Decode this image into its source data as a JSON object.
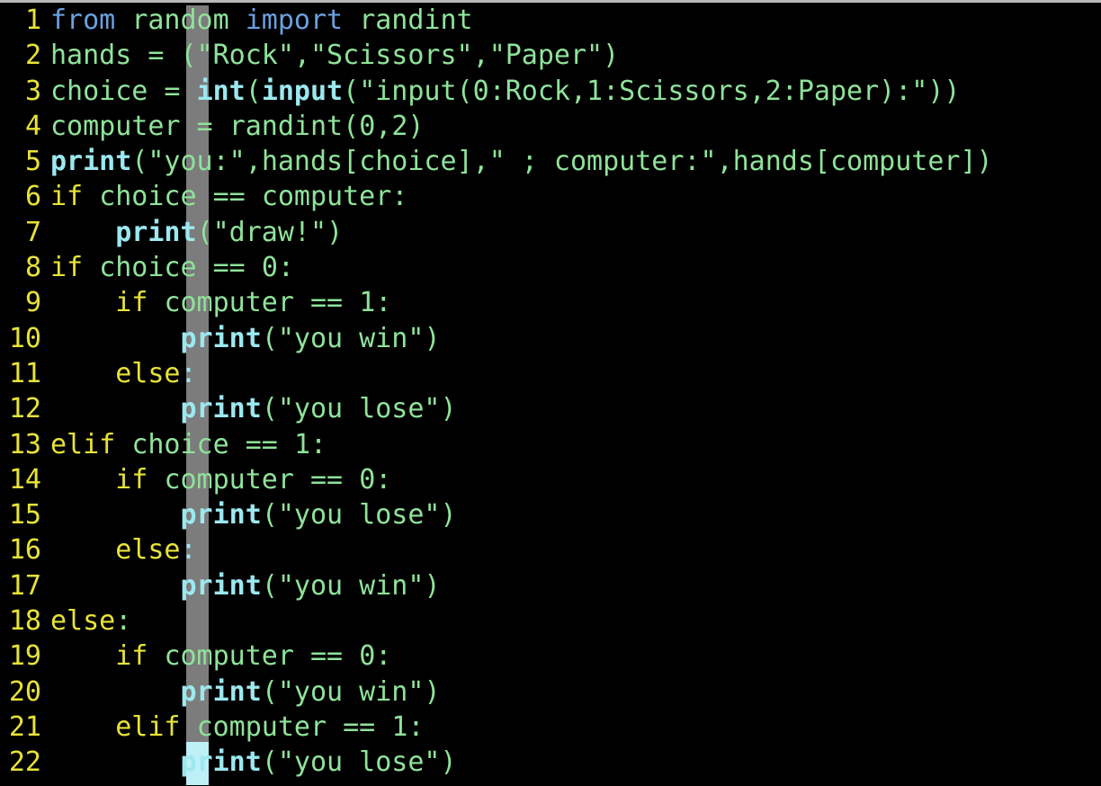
{
  "editor": {
    "title": "python-code-editor",
    "language": "Python",
    "background_color": "#000000",
    "gutter_color": "#e8e337",
    "indent_guide_color": "#7c7c7c",
    "cursor_color": "#bdf0f7",
    "top_border_color": "#b9b9b9",
    "total_lines": 22,
    "cursor": {
      "line": 22,
      "column": 9
    },
    "palette": {
      "keyword": "#e8e337",
      "import": "#6aa0e0",
      "builtin": "#9ce8f0",
      "identifier": "#8fe39a",
      "string": "#8fe39a",
      "number": "#8fe39a",
      "operator": "#8fe39a"
    }
  },
  "lines": [
    {
      "number": "1",
      "text": "from random import randint",
      "tokens": [
        {
          "t": "from",
          "c": "tk-import"
        },
        {
          "t": " ",
          "c": "tk-op"
        },
        {
          "t": "random",
          "c": "tk-name"
        },
        {
          "t": " ",
          "c": "tk-op"
        },
        {
          "t": "import",
          "c": "tk-import"
        },
        {
          "t": " ",
          "c": "tk-op"
        },
        {
          "t": "randint",
          "c": "tk-name"
        }
      ]
    },
    {
      "number": "2",
      "text": "hands = (\"Rock\",\"Scissors\",\"Paper\")",
      "tokens": [
        {
          "t": "hands",
          "c": "tk-name"
        },
        {
          "t": " = (",
          "c": "tk-op"
        },
        {
          "t": "\"Rock\"",
          "c": "tk-str"
        },
        {
          "t": ",",
          "c": "tk-op"
        },
        {
          "t": "\"Scissors\"",
          "c": "tk-str"
        },
        {
          "t": ",",
          "c": "tk-op"
        },
        {
          "t": "\"Paper\"",
          "c": "tk-str"
        },
        {
          "t": ")",
          "c": "tk-op"
        }
      ]
    },
    {
      "number": "3",
      "text": "choice = int(input(\"input(0:Rock,1:Scissors,2:Paper):\"))",
      "tokens": [
        {
          "t": "choice",
          "c": "tk-name"
        },
        {
          "t": " = ",
          "c": "tk-op"
        },
        {
          "t": "int",
          "c": "tk-builtin"
        },
        {
          "t": "(",
          "c": "tk-op"
        },
        {
          "t": "input",
          "c": "tk-builtin"
        },
        {
          "t": "(",
          "c": "tk-op"
        },
        {
          "t": "\"input(0:Rock,1:Scissors,2:Paper):\"",
          "c": "tk-str"
        },
        {
          "t": "))",
          "c": "tk-op"
        }
      ]
    },
    {
      "number": "4",
      "text": "computer = randint(0,2)",
      "tokens": [
        {
          "t": "computer",
          "c": "tk-name"
        },
        {
          "t": " = ",
          "c": "tk-op"
        },
        {
          "t": "randint",
          "c": "tk-name"
        },
        {
          "t": "(",
          "c": "tk-op"
        },
        {
          "t": "0",
          "c": "tk-num"
        },
        {
          "t": ",",
          "c": "tk-op"
        },
        {
          "t": "2",
          "c": "tk-num"
        },
        {
          "t": ")",
          "c": "tk-op"
        }
      ]
    },
    {
      "number": "5",
      "text": "print(\"you:\",hands[choice],\" ; computer:\",hands[computer])",
      "tokens": [
        {
          "t": "print",
          "c": "tk-builtin"
        },
        {
          "t": "(",
          "c": "tk-op"
        },
        {
          "t": "\"you:\"",
          "c": "tk-str"
        },
        {
          "t": ",",
          "c": "tk-op"
        },
        {
          "t": "hands",
          "c": "tk-name"
        },
        {
          "t": "[",
          "c": "tk-op"
        },
        {
          "t": "choice",
          "c": "tk-name"
        },
        {
          "t": "],",
          "c": "tk-op"
        },
        {
          "t": "\" ; computer:\"",
          "c": "tk-str"
        },
        {
          "t": ",",
          "c": "tk-op"
        },
        {
          "t": "hands",
          "c": "tk-name"
        },
        {
          "t": "[",
          "c": "tk-op"
        },
        {
          "t": "computer",
          "c": "tk-name"
        },
        {
          "t": "])",
          "c": "tk-op"
        }
      ]
    },
    {
      "number": "6",
      "text": "if choice == computer:",
      "tokens": [
        {
          "t": "if",
          "c": "tk-kw"
        },
        {
          "t": " ",
          "c": "tk-op"
        },
        {
          "t": "choice",
          "c": "tk-name"
        },
        {
          "t": " == ",
          "c": "tk-op"
        },
        {
          "t": "computer",
          "c": "tk-name"
        },
        {
          "t": ":",
          "c": "tk-op"
        }
      ]
    },
    {
      "number": "7",
      "text": "    print(\"draw!\")",
      "tokens": [
        {
          "t": "    ",
          "c": "tk-op"
        },
        {
          "t": "print",
          "c": "tk-builtin"
        },
        {
          "t": "(",
          "c": "tk-op"
        },
        {
          "t": "\"draw!\"",
          "c": "tk-str"
        },
        {
          "t": ")",
          "c": "tk-op"
        }
      ]
    },
    {
      "number": "8",
      "text": "if choice == 0:",
      "tokens": [
        {
          "t": "if",
          "c": "tk-kw"
        },
        {
          "t": " ",
          "c": "tk-op"
        },
        {
          "t": "choice",
          "c": "tk-name"
        },
        {
          "t": " == ",
          "c": "tk-op"
        },
        {
          "t": "0",
          "c": "tk-num"
        },
        {
          "t": ":",
          "c": "tk-op"
        }
      ]
    },
    {
      "number": "9",
      "text": "    if computer == 1:",
      "tokens": [
        {
          "t": "    ",
          "c": "tk-op"
        },
        {
          "t": "if",
          "c": "tk-kw"
        },
        {
          "t": " ",
          "c": "tk-op"
        },
        {
          "t": "computer",
          "c": "tk-name"
        },
        {
          "t": " == ",
          "c": "tk-op"
        },
        {
          "t": "1",
          "c": "tk-num"
        },
        {
          "t": ":",
          "c": "tk-op"
        }
      ]
    },
    {
      "number": "10",
      "text": "        print(\"you win\")",
      "tokens": [
        {
          "t": "        ",
          "c": "tk-op"
        },
        {
          "t": "print",
          "c": "tk-builtin"
        },
        {
          "t": "(",
          "c": "tk-op"
        },
        {
          "t": "\"you win\"",
          "c": "tk-str"
        },
        {
          "t": ")",
          "c": "tk-op"
        }
      ]
    },
    {
      "number": "11",
      "text": "    else:",
      "tokens": [
        {
          "t": "    ",
          "c": "tk-op"
        },
        {
          "t": "else",
          "c": "tk-kw"
        },
        {
          "t": ":",
          "c": "tk-colon"
        }
      ]
    },
    {
      "number": "12",
      "text": "        print(\"you lose\")",
      "tokens": [
        {
          "t": "        ",
          "c": "tk-op"
        },
        {
          "t": "print",
          "c": "tk-builtin"
        },
        {
          "t": "(",
          "c": "tk-op"
        },
        {
          "t": "\"you lose\"",
          "c": "tk-str"
        },
        {
          "t": ")",
          "c": "tk-op"
        }
      ]
    },
    {
      "number": "13",
      "text": "elif choice == 1:",
      "tokens": [
        {
          "t": "elif",
          "c": "tk-kw"
        },
        {
          "t": " ",
          "c": "tk-op"
        },
        {
          "t": "choice",
          "c": "tk-name"
        },
        {
          "t": " == ",
          "c": "tk-op"
        },
        {
          "t": "1",
          "c": "tk-num"
        },
        {
          "t": ":",
          "c": "tk-op"
        }
      ]
    },
    {
      "number": "14",
      "text": "    if computer == 0:",
      "tokens": [
        {
          "t": "    ",
          "c": "tk-op"
        },
        {
          "t": "if",
          "c": "tk-kw"
        },
        {
          "t": " ",
          "c": "tk-op"
        },
        {
          "t": "computer",
          "c": "tk-name"
        },
        {
          "t": " == ",
          "c": "tk-op"
        },
        {
          "t": "0",
          "c": "tk-num"
        },
        {
          "t": ":",
          "c": "tk-op"
        }
      ]
    },
    {
      "number": "15",
      "text": "        print(\"you lose\")",
      "tokens": [
        {
          "t": "        ",
          "c": "tk-op"
        },
        {
          "t": "print",
          "c": "tk-builtin"
        },
        {
          "t": "(",
          "c": "tk-op"
        },
        {
          "t": "\"you lose\"",
          "c": "tk-str"
        },
        {
          "t": ")",
          "c": "tk-op"
        }
      ]
    },
    {
      "number": "16",
      "text": "    else:",
      "tokens": [
        {
          "t": "    ",
          "c": "tk-op"
        },
        {
          "t": "else",
          "c": "tk-kw"
        },
        {
          "t": ":",
          "c": "tk-colon"
        }
      ]
    },
    {
      "number": "17",
      "text": "        print(\"you win\")",
      "tokens": [
        {
          "t": "        ",
          "c": "tk-op"
        },
        {
          "t": "print",
          "c": "tk-builtin"
        },
        {
          "t": "(",
          "c": "tk-op"
        },
        {
          "t": "\"you win\"",
          "c": "tk-str"
        },
        {
          "t": ")",
          "c": "tk-op"
        }
      ]
    },
    {
      "number": "18",
      "text": "else:",
      "tokens": [
        {
          "t": "else",
          "c": "tk-kw"
        },
        {
          "t": ":",
          "c": "tk-op"
        }
      ]
    },
    {
      "number": "19",
      "text": "    if computer == 0:",
      "tokens": [
        {
          "t": "    ",
          "c": "tk-op"
        },
        {
          "t": "if",
          "c": "tk-kw"
        },
        {
          "t": " ",
          "c": "tk-op"
        },
        {
          "t": "computer",
          "c": "tk-name"
        },
        {
          "t": " == ",
          "c": "tk-op"
        },
        {
          "t": "0",
          "c": "tk-num"
        },
        {
          "t": ":",
          "c": "tk-op"
        }
      ]
    },
    {
      "number": "20",
      "text": "        print(\"you win\")",
      "tokens": [
        {
          "t": "        ",
          "c": "tk-op"
        },
        {
          "t": "print",
          "c": "tk-builtin"
        },
        {
          "t": "(",
          "c": "tk-op"
        },
        {
          "t": "\"you win\"",
          "c": "tk-str"
        },
        {
          "t": ")",
          "c": "tk-op"
        }
      ]
    },
    {
      "number": "21",
      "text": "    elif computer == 1:",
      "tokens": [
        {
          "t": "    ",
          "c": "tk-op"
        },
        {
          "t": "elif",
          "c": "tk-kw"
        },
        {
          "t": " ",
          "c": "tk-op"
        },
        {
          "t": "computer",
          "c": "tk-name"
        },
        {
          "t": " == ",
          "c": "tk-op"
        },
        {
          "t": "1",
          "c": "tk-num"
        },
        {
          "t": ":",
          "c": "tk-op"
        }
      ]
    },
    {
      "number": "22",
      "text": "        print(\"you lose\")",
      "tokens": [
        {
          "t": "        ",
          "c": "tk-op"
        },
        {
          "t": "print",
          "c": "tk-builtin"
        },
        {
          "t": "(",
          "c": "tk-op"
        },
        {
          "t": "\"you lose\"",
          "c": "tk-str"
        },
        {
          "t": ")",
          "c": "tk-op"
        }
      ]
    }
  ]
}
